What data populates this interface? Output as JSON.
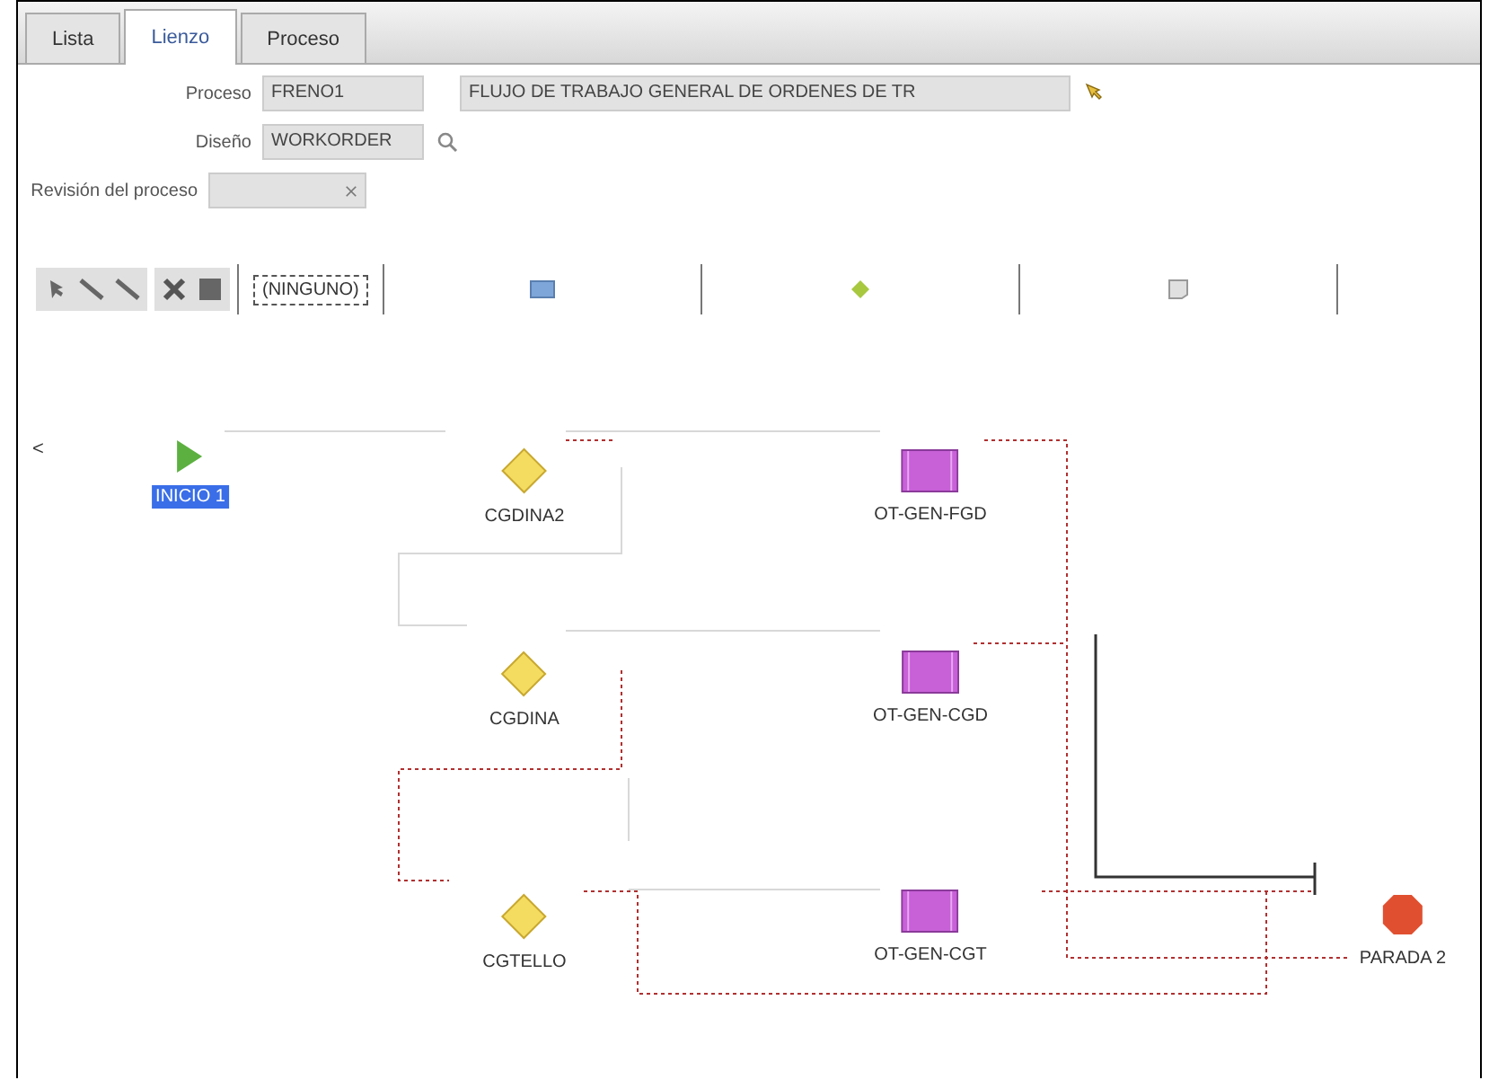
{
  "tabs": [
    {
      "label": "Lista",
      "selected": false
    },
    {
      "label": "Lienzo",
      "selected": true
    },
    {
      "label": "Proceso",
      "selected": false
    }
  ],
  "form": {
    "process_label": "Proceso",
    "process_code": "FRENO1",
    "process_name": "FLUJO DE TRABAJO GENERAL DE ORDENES DE TR",
    "design_label": "Diseño",
    "design_value": "WORKORDER",
    "revision_label": "Revisión del proceso"
  },
  "toolbar": {
    "dropdown": "(NINGUNO)"
  },
  "canvas": {
    "scroll_left": "<",
    "nodes": [
      {
        "kind": "start",
        "label": "INICIO 1",
        "selected": true
      },
      {
        "kind": "decision",
        "label": "CGDINA2",
        "selected": false
      },
      {
        "kind": "task",
        "label": "OT-GEN-FGD",
        "selected": false
      },
      {
        "kind": "decision",
        "label": "CGDINA",
        "selected": false
      },
      {
        "kind": "task",
        "label": "OT-GEN-CGD",
        "selected": false
      },
      {
        "kind": "decision",
        "label": "CGTELLO",
        "selected": false
      },
      {
        "kind": "task",
        "label": "OT-GEN-CGT",
        "selected": false
      },
      {
        "kind": "stop",
        "label": "PARADA 2",
        "selected": false
      }
    ]
  }
}
